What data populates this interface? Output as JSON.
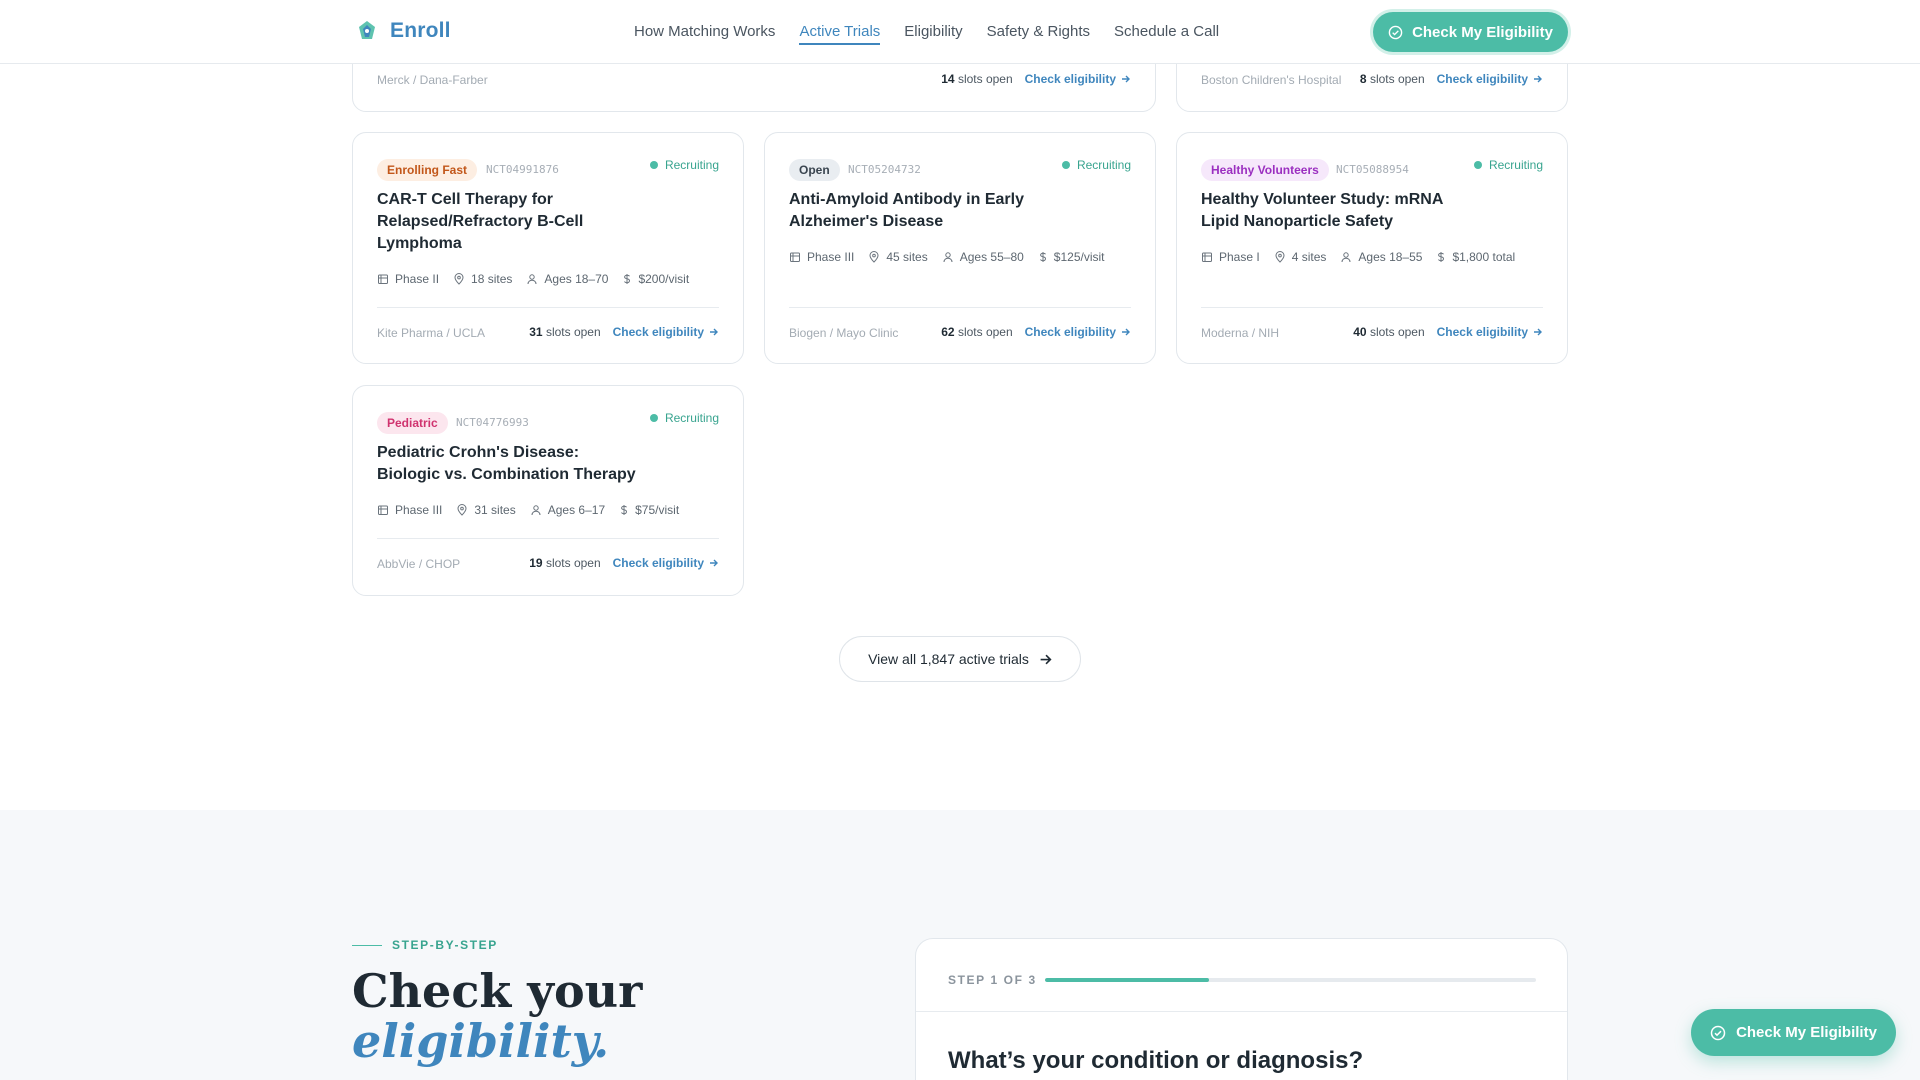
{
  "header": {
    "brand": "Enroll",
    "nav": [
      "How Matching Works",
      "Active Trials",
      "Eligibility",
      "Safety & Rights",
      "Schedule a Call"
    ],
    "active_nav": "Active Trials",
    "cta": "Check My Eligibility"
  },
  "partial_cards": [
    {
      "sponsor": "Merck / Dana-Farber",
      "slots_count": "14",
      "slots_text": "slots open",
      "link": "Check eligibility"
    },
    {
      "sponsor": "Boston Children's Hospital",
      "slots_count": "8",
      "slots_text": "slots open",
      "link": "Check eligibility"
    }
  ],
  "trials": [
    {
      "badge": "Enrolling Fast",
      "badge_color": "#c2571a",
      "badge_bg": "#fdeee2",
      "nct": "NCT04991876",
      "status": "Recruiting",
      "title_lines": [
        "CAR-T Cell Therapy for",
        "Relapsed/Refractory B-Cell",
        "Lymphoma"
      ],
      "phase": "Phase II",
      "sites": "18 sites",
      "ages": "Ages 18–70",
      "pay": "$200/visit",
      "sponsor": "Kite Pharma / UCLA",
      "slots_count": "31",
      "slots_text": "slots open",
      "link": "Check eligibility"
    },
    {
      "badge": "Open",
      "badge_color": "#3a4550",
      "badge_bg": "#e9edf1",
      "nct": "NCT05204732",
      "status": "Recruiting",
      "title_lines": [
        "Anti-Amyloid Antibody in Early",
        "Alzheimer's Disease"
      ],
      "phase": "Phase III",
      "sites": "45 sites",
      "ages": "Ages 55–80",
      "pay": "$125/visit",
      "sponsor": "Biogen / Mayo Clinic",
      "slots_count": "62",
      "slots_text": "slots open",
      "link": "Check eligibility"
    },
    {
      "badge": "Healthy Volunteers",
      "badge_color": "#9b2fc0",
      "badge_bg": "#f6e8fb",
      "nct": "NCT05088954",
      "status": "Recruiting",
      "title_lines": [
        "Healthy Volunteer Study: mRNA",
        "Lipid Nanoparticle Safety"
      ],
      "phase": "Phase I",
      "sites": "4 sites",
      "ages": "Ages 18–55",
      "pay": "$1,800 total",
      "sponsor": "Moderna / NIH",
      "slots_count": "40",
      "slots_text": "slots open",
      "link": "Check eligibility"
    },
    {
      "badge": "Pediatric",
      "badge_color": "#d0336f",
      "badge_bg": "#fce6ee",
      "nct": "NCT04776993",
      "status": "Recruiting",
      "title_lines": [
        "Pediatric Crohn's Disease:",
        "Biologic vs. Combination Therapy"
      ],
      "phase": "Phase III",
      "sites": "31 sites",
      "ages": "Ages 6–17",
      "pay": "$75/visit",
      "sponsor": "AbbVie / CHOP",
      "slots_count": "19",
      "slots_text": "slots open",
      "link": "Check eligibility"
    }
  ],
  "view_all": "View all 1,847 active trials",
  "eligibility": {
    "eyebrow": "STEP-BY-STEP",
    "headline_1": "Check your",
    "headline_2": "eligibility.",
    "step_label": "STEP 1 OF 3",
    "progress_fraction": 0.333,
    "question": "What’s your condition or diagnosis?"
  },
  "floating_cta": "Check My Eligibility",
  "colors": {
    "accent": "#4cbca6",
    "brand": "#3f86bd"
  }
}
